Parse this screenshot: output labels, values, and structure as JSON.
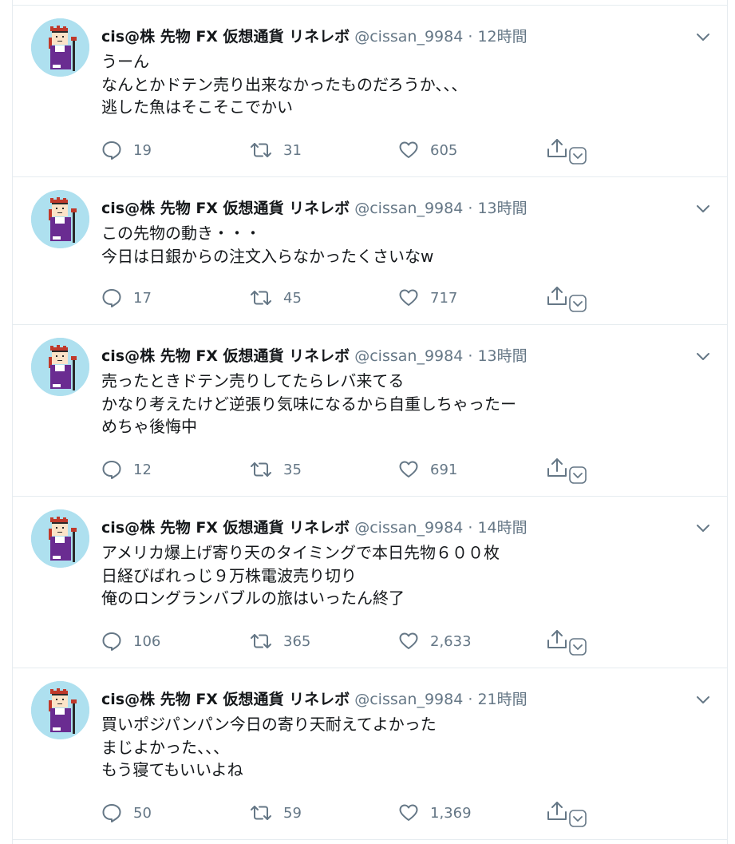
{
  "timeline": {
    "tweets": [
      {
        "name": "cis@株 先物 FX 仮想通貨 リネレボ",
        "handle": "@cissan_9984",
        "separator": "·",
        "time": "12時間",
        "text": "うーん\nなんとかドテン売り出来なかったものだろうか、、、\n逃した魚はそこそこでかい",
        "replies": "19",
        "retweets": "31",
        "likes": "605"
      },
      {
        "name": "cis@株 先物 FX 仮想通貨 リネレボ",
        "handle": "@cissan_9984",
        "separator": "·",
        "time": "13時間",
        "text": "この先物の動き・・・\n今日は日銀からの注文入らなかったくさいなw",
        "replies": "17",
        "retweets": "45",
        "likes": "717"
      },
      {
        "name": "cis@株 先物 FX 仮想通貨 リネレボ",
        "handle": "@cissan_9984",
        "separator": "·",
        "time": "13時間",
        "text": "売ったときドテン売りしてたらレバ来てる\nかなり考えたけど逆張り気味になるから自重しちゃったー\nめちゃ後悔中",
        "replies": "12",
        "retweets": "35",
        "likes": "691"
      },
      {
        "name": "cis@株 先物 FX 仮想通貨 リネレボ",
        "handle": "@cissan_9984",
        "separator": "·",
        "time": "14時間",
        "text": "アメリカ爆上げ寄り天のタイミングで本日先物６００枚\n日経びばれっじ９万株電波売り切り\n俺のロングランバブルの旅はいったん終了",
        "replies": "106",
        "retweets": "365",
        "likes": "2,633"
      },
      {
        "name": "cis@株 先物 FX 仮想通貨 リネレボ",
        "handle": "@cissan_9984",
        "separator": "·",
        "time": "21時間",
        "text": "買いポジパンパン今日の寄り天耐えてよかった\nまじよかった、、、\nもう寝てもいいよね",
        "replies": "50",
        "retweets": "59",
        "likes": "1,369"
      }
    ]
  },
  "icons": {
    "reply": "reply-icon",
    "retweet": "retweet-icon",
    "like": "like-icon",
    "share": "share-icon",
    "caret": "chevron-down-icon"
  },
  "colors": {
    "text": "#14171a",
    "secondary": "#657786",
    "border": "#e6ecf0",
    "avatar_bg": "#aee0ef"
  }
}
